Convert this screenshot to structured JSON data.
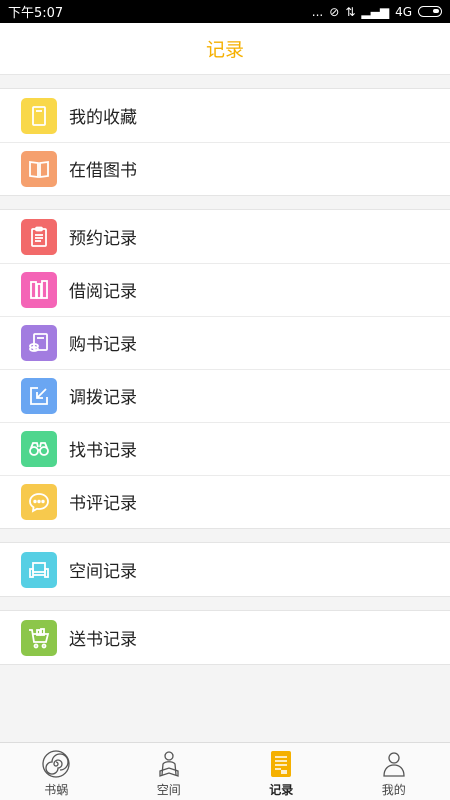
{
  "statusbar": {
    "time": "下午5:07",
    "dots": "...",
    "network": "4G"
  },
  "header": {
    "title": "记录"
  },
  "groups": [
    {
      "items": [
        {
          "label": "我的收藏",
          "icon": "bookmark-icon",
          "color": "#f9d84a"
        },
        {
          "label": "在借图书",
          "icon": "open-book-icon",
          "color": "#f5a06e"
        }
      ]
    },
    {
      "items": [
        {
          "label": "预约记录",
          "icon": "clipboard-icon",
          "color": "#f26a6a"
        },
        {
          "label": "借阅记录",
          "icon": "books-icon",
          "color": "#f464b6"
        },
        {
          "label": "购书记录",
          "icon": "book-purchase-icon",
          "color": "#a27ce0"
        },
        {
          "label": "调拨记录",
          "icon": "transfer-arrow-icon",
          "color": "#6aa6f2"
        },
        {
          "label": "找书记录",
          "icon": "binoculars-icon",
          "color": "#4fd68e"
        },
        {
          "label": "书评记录",
          "icon": "chat-bubble-icon",
          "color": "#f7c94d"
        }
      ]
    },
    {
      "items": [
        {
          "label": "空间记录",
          "icon": "sofa-icon",
          "color": "#56cfe4"
        }
      ]
    },
    {
      "items": [
        {
          "label": "送书记录",
          "icon": "cart-icon",
          "color": "#8cc64a"
        }
      ]
    }
  ],
  "tabs": [
    {
      "label": "书蜗",
      "icon": "snail-shell-icon",
      "active": false
    },
    {
      "label": "空间",
      "icon": "reading-person-icon",
      "active": false
    },
    {
      "label": "记录",
      "icon": "record-list-icon",
      "active": true,
      "color": "#f5b000"
    },
    {
      "label": "我的",
      "icon": "user-icon",
      "active": false
    }
  ]
}
